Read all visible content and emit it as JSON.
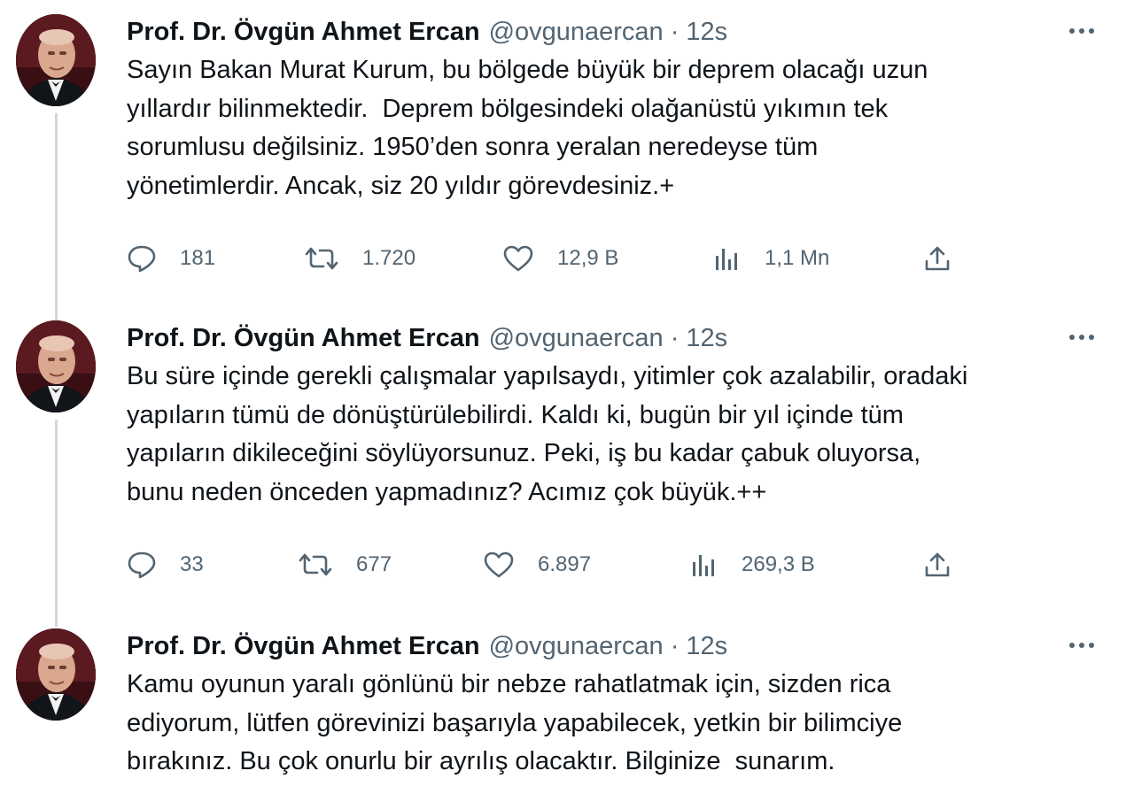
{
  "tweets": [
    {
      "author_name": "Prof. Dr. Övgün Ahmet Ercan",
      "handle": "@ovgunaercan",
      "separator": "·",
      "time": "12s",
      "text": "Sayın Bakan Murat Kurum, bu bölgede büyük bir deprem olacağı uzun\nyıllardır bilinmektedir.  Deprem bölgesindeki olağanüstü yıkımın tek\nsorumlusu değilsiniz. 1950’den sonra yeralan neredeyse tüm\nyönetimlerdir. Ancak, siz 20 yıldır görevdesiniz.+",
      "replies": "181",
      "retweets": "1.720",
      "likes": "12,9 B",
      "views": "1,1 Mn"
    },
    {
      "author_name": "Prof. Dr. Övgün Ahmet Ercan",
      "handle": "@ovgunaercan",
      "separator": "·",
      "time": "12s",
      "text": "Bu süre içinde gerekli çalışmalar yapılsaydı, yitimler çok azalabilir, oradaki\nyapıların tümü de dönüştürülebilirdi. Kaldı ki, bugün bir yıl içinde tüm\nyapıların dikileceğini söylüyorsunuz. Peki, iş bu kadar çabuk oluyorsa,\nbunu neden önceden yapmadınız? Acımız çok büyük.++",
      "replies": "33",
      "retweets": "677",
      "likes": "6.897",
      "views": "269,3 B"
    },
    {
      "author_name": "Prof. Dr. Övgün Ahmet Ercan",
      "handle": "@ovgunaercan",
      "separator": "·",
      "time": "12s",
      "text": "Kamu oyunun yaralı gönlünü bir nebze rahatlatmak için, sizden rica\nediyorum, lütfen görevinizi başarıyla yapabilecek, yetkin bir bilimciye\nbırakınız. Bu çok onurlu bir ayrılış olacaktır. Bilginize  sunarım."
    }
  ],
  "icons": {
    "reply": "reply-icon",
    "retweet": "retweet-icon",
    "like": "heart-icon",
    "views": "analytics-icon",
    "share": "share-icon",
    "more": "more-dots-icon"
  },
  "colors": {
    "text": "#0f1419",
    "secondary": "#536471",
    "thread_line": "#cfd9de"
  }
}
